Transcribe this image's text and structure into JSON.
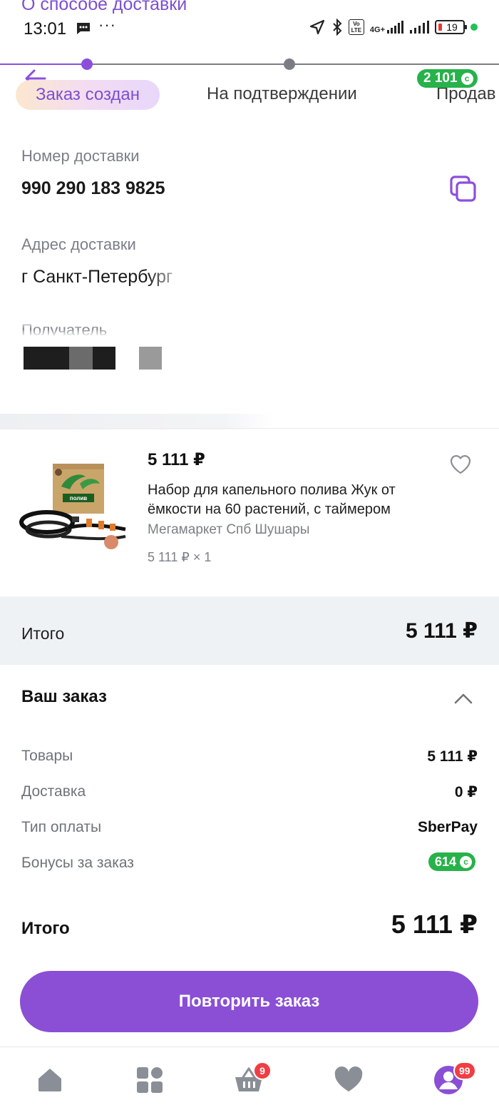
{
  "header": {
    "scrolled_title": "О способе доставки"
  },
  "status_bar": {
    "time": "13:01",
    "dots": "···",
    "network": "4G+",
    "volte": "Vo LTE",
    "battery": "19"
  },
  "stepper": {
    "active_step": "Заказ создан",
    "step_2": "На подтверждении",
    "step_3": "Продав",
    "bonus_balance": "2 101"
  },
  "delivery": {
    "number_label": "Номер доставки",
    "number_value": "990 290 183 9825",
    "address_label": "Адрес доставки",
    "address_value": "г Санкт-Петербург",
    "recipient_label": "Получатель"
  },
  "product": {
    "price": "5 111 ₽",
    "name": "Набор для капельного полива Жук от ёмкости на 60 растений, с таймером",
    "seller": "Мегамаркет Спб Шушары",
    "qty": "5 111 ₽ × 1",
    "box_text": "полив"
  },
  "total_band": {
    "label": "Итого",
    "value": "5 111 ₽"
  },
  "order": {
    "title": "Ваш заказ",
    "rows": [
      {
        "label": "Товары",
        "value": "5 111 ₽"
      },
      {
        "label": "Доставка",
        "value": "0 ₽"
      },
      {
        "label": "Тип оплаты",
        "value": "SberPay"
      },
      {
        "label": "Бонусы за заказ",
        "value": "614"
      }
    ],
    "final_label": "Итого",
    "final_value": "5 111 ₽",
    "repeat_button": "Повторить заказ"
  },
  "tab_bar": {
    "cart_badge": "9",
    "profile_badge": "99"
  },
  "colors": {
    "accent": "#8a4fd4",
    "bonus_green": "#27b24a",
    "badge_red": "#ef3e44"
  },
  "icons": {
    "back": "arrow-left-icon",
    "copy": "copy-icon",
    "favorite": "heart-outline-icon",
    "collapse": "chevron-up-icon",
    "home": "home-icon",
    "catalog": "catalog-icon",
    "cart": "basket-icon",
    "favorites": "heart-icon",
    "profile": "profile-icon"
  }
}
